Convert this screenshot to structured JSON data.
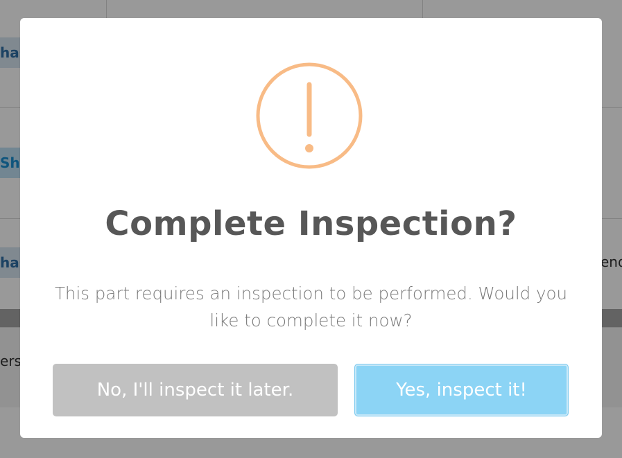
{
  "background": {
    "tags": [
      "has",
      "Sh",
      "has"
    ],
    "right_text": "end",
    "footer_text": "ers"
  },
  "dialog": {
    "icon": "exclamation-circle-icon",
    "icon_color": "#f8bb86",
    "title": "Complete Inspection?",
    "text": "This part requires an inspection to be performed. Would you like to complete it now?",
    "cancel_label": "No, I'll inspect it later.",
    "confirm_label": "Yes, inspect it!",
    "cancel_color": "#c1c1c1",
    "confirm_color": "#8cd4f5"
  }
}
